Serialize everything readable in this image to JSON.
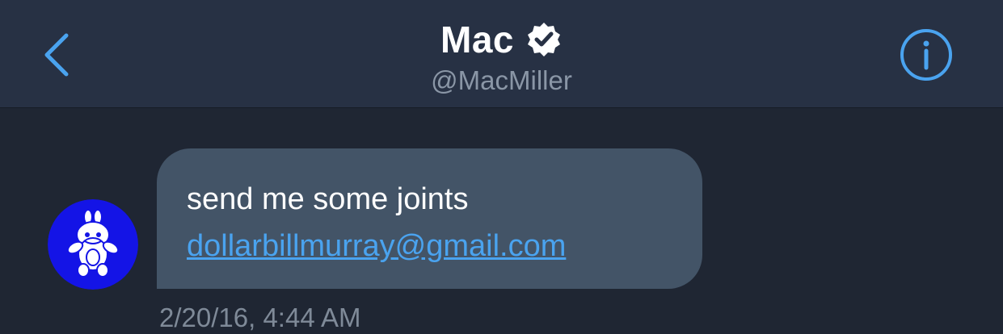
{
  "header": {
    "title": "Mac",
    "handle": "@MacMiller",
    "back_icon": "chevron-left-icon",
    "verified_icon": "verified-badge-icon",
    "info_icon": "info-circle-icon"
  },
  "message": {
    "lines": [
      "send me some joints"
    ],
    "link": "dollarbillmurray@gmail.com",
    "timestamp": "2/20/16, 4:44 AM"
  },
  "colors": {
    "background": "#1f2633",
    "header": "#273144",
    "bubble": "#435467",
    "accent": "#4aa3ef",
    "avatar": "#1414e6"
  }
}
